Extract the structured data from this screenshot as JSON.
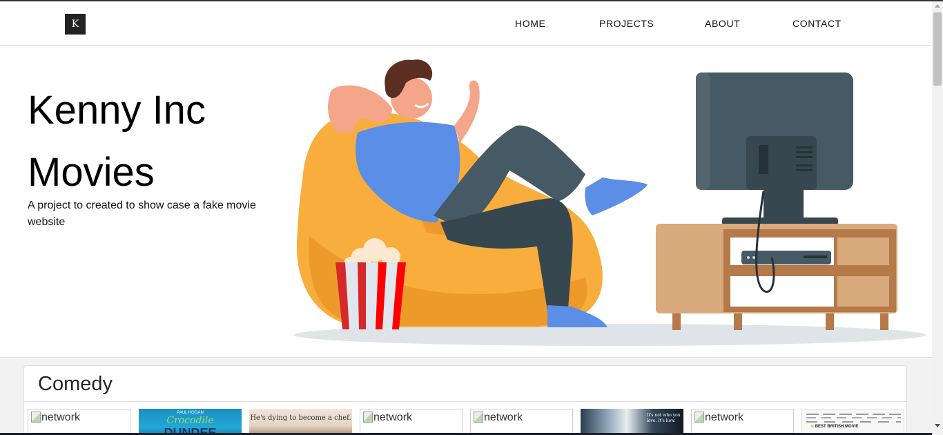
{
  "brand": {
    "logo_letter": "K"
  },
  "nav": {
    "items": [
      {
        "label": "HOME"
      },
      {
        "label": "PROJECTS"
      },
      {
        "label": "ABOUT"
      },
      {
        "label": "CONTACT"
      }
    ]
  },
  "hero": {
    "title_line1": "Kenny Inc",
    "title_line2": "Movies",
    "subtitle": "A project to created to show case a fake movie website"
  },
  "section": {
    "title": "Comedy",
    "posters": [
      {
        "kind": "broken",
        "alt": "network"
      },
      {
        "kind": "image",
        "title_top": "PAUL HOGAN",
        "title_main": "Crocodile",
        "title_sub": "DUNDEE"
      },
      {
        "kind": "image",
        "tagline": "He's dying to become a chef."
      },
      {
        "kind": "broken",
        "alt": "network"
      },
      {
        "kind": "broken",
        "alt": "network"
      },
      {
        "kind": "image",
        "tagline": "It's not who you love. It's how."
      },
      {
        "kind": "broken",
        "alt": "network"
      },
      {
        "kind": "image",
        "tagline": "BEST BRITISH MOVIE"
      }
    ]
  },
  "colors": {
    "beanbag": "#f9ad3c",
    "shirt": "#5b8ee6",
    "pants": "#455a64",
    "tv": "#455a64",
    "cabinet": "#b5794a",
    "popcorn_red": "#d62828"
  }
}
